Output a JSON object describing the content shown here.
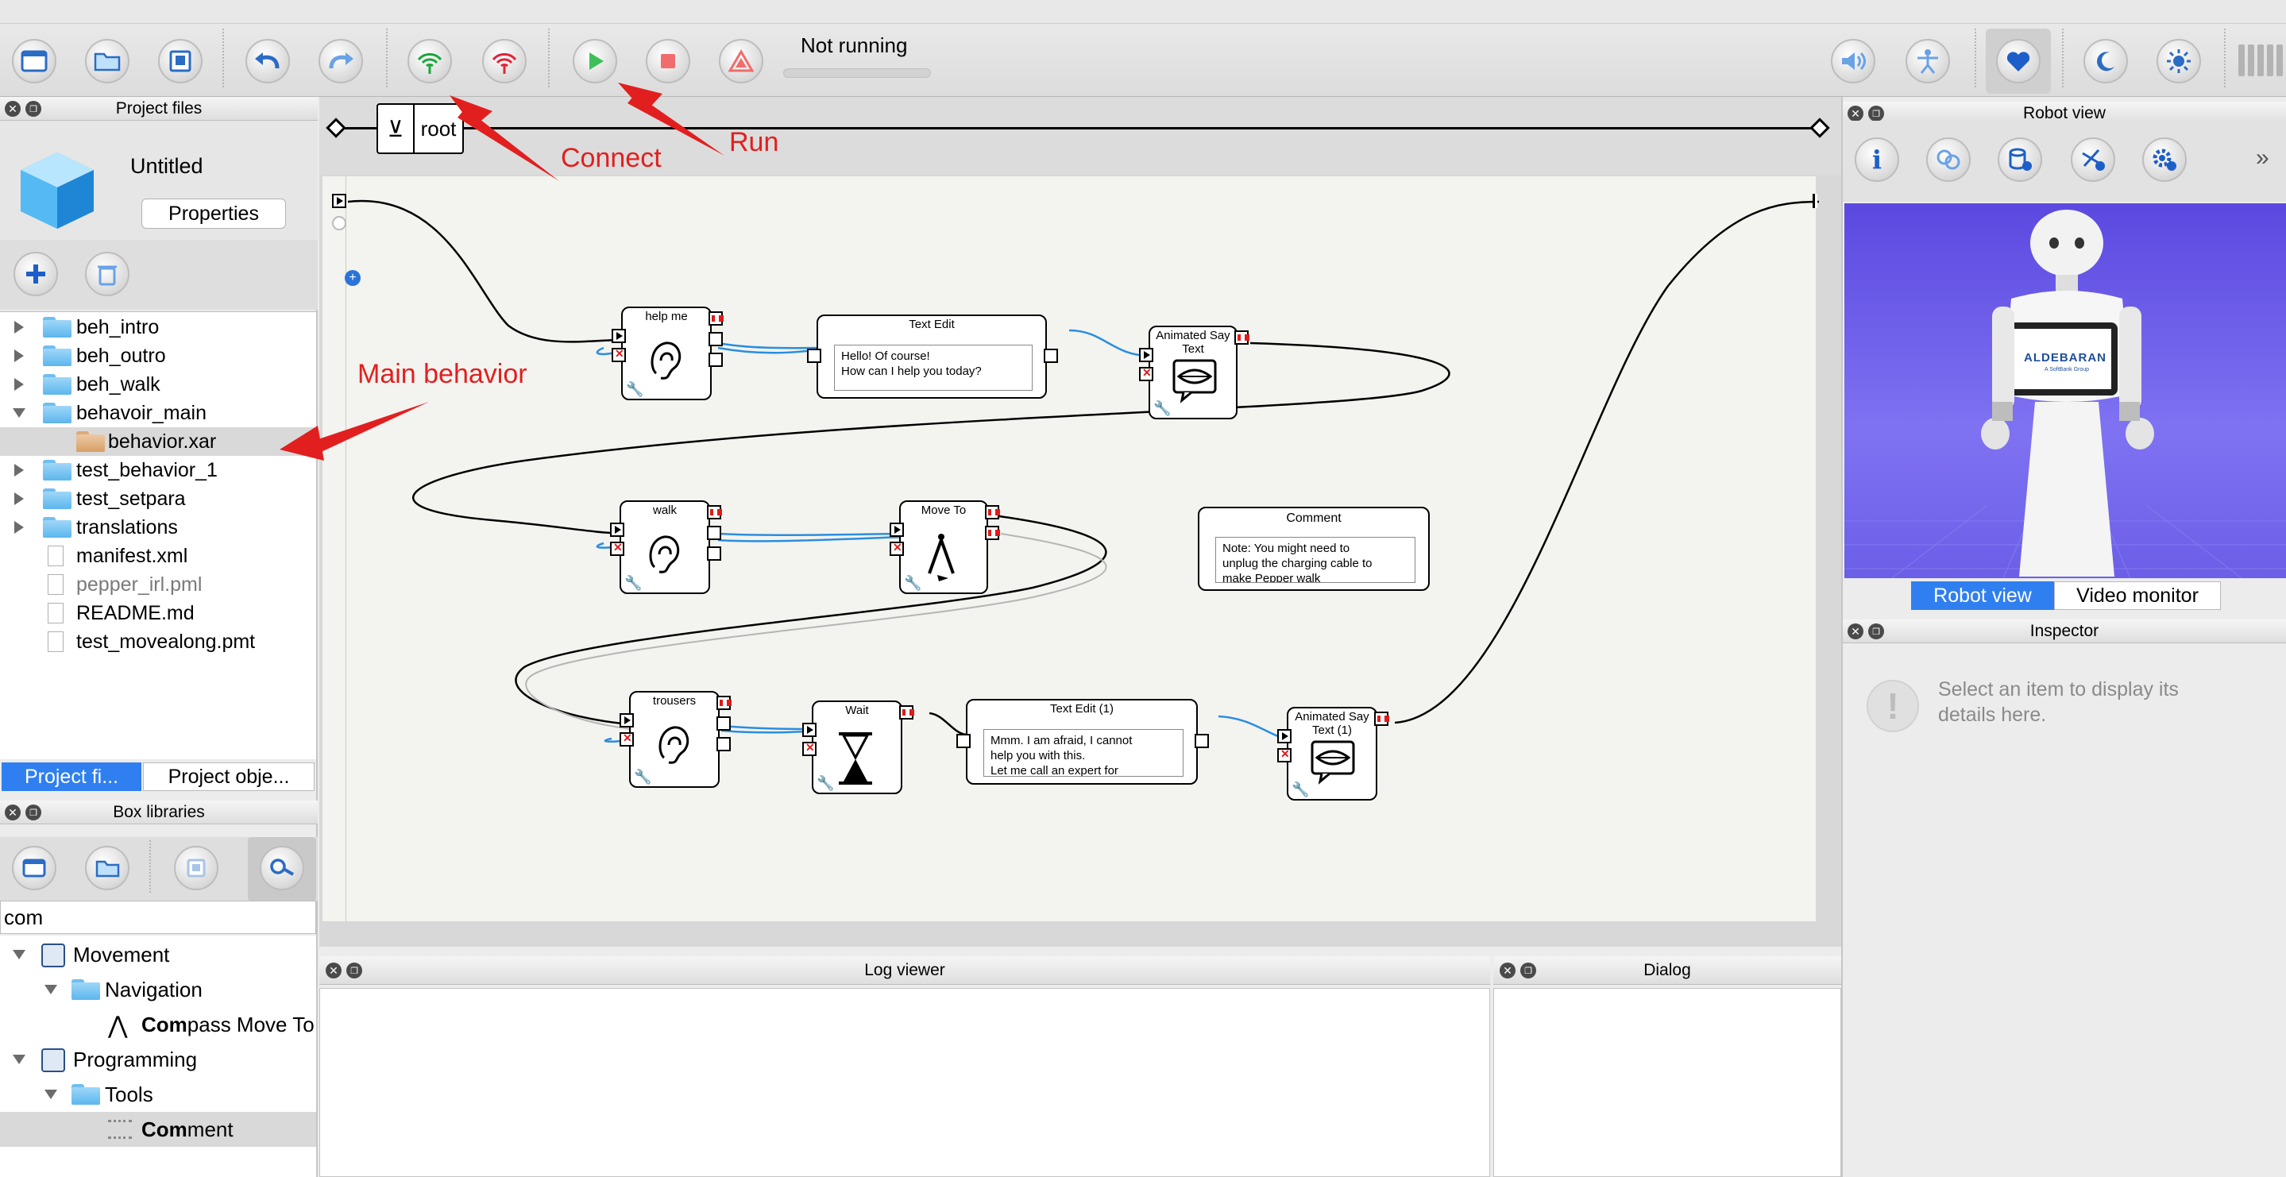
{
  "toolbar": {
    "status": "Not running",
    "buttons": [
      "new-project",
      "open-project",
      "save-project",
      "undo",
      "redo",
      "connect",
      "disconnect",
      "play",
      "stop",
      "alert"
    ],
    "right_buttons": [
      "volume",
      "animation-mode",
      "autonomous-life",
      "rest",
      "wake-up"
    ]
  },
  "project_files": {
    "header": "Project files",
    "project_name": "Untitled",
    "properties_label": "Properties",
    "tree": [
      {
        "label": "beh_intro",
        "type": "folder",
        "expand": "right"
      },
      {
        "label": "beh_outro",
        "type": "folder",
        "expand": "right"
      },
      {
        "label": "beh_walk",
        "type": "folder",
        "expand": "right"
      },
      {
        "label": "behavoir_main",
        "type": "folder",
        "expand": "down"
      },
      {
        "label": "behavior.xar",
        "type": "xar",
        "expand": "",
        "indent": true,
        "selected": true
      },
      {
        "label": "test_behavior_1",
        "type": "folder",
        "expand": "right"
      },
      {
        "label": "test_setpara",
        "type": "folder",
        "expand": "right"
      },
      {
        "label": "translations",
        "type": "folder",
        "expand": "right"
      },
      {
        "label": "manifest.xml",
        "type": "file",
        "expand": ""
      },
      {
        "label": "pepper_irl.pml",
        "type": "pml",
        "expand": "",
        "muted": true
      },
      {
        "label": "README.md",
        "type": "file",
        "expand": ""
      },
      {
        "label": "test_movealong.pmt",
        "type": "file",
        "expand": ""
      }
    ],
    "tabs": [
      "Project fi...",
      "Project obje..."
    ]
  },
  "box_libraries": {
    "header": "Box libraries",
    "search_value": "com",
    "tree": [
      {
        "label": "Movement",
        "level": 0,
        "icon": "library"
      },
      {
        "label": "Navigation",
        "level": 1,
        "icon": "folder"
      },
      {
        "match": "Com",
        "rest": "pass Move To",
        "level": 2,
        "icon": "compass-box"
      },
      {
        "label": "Programming",
        "level": 0,
        "icon": "library"
      },
      {
        "label": "Tools",
        "level": 1,
        "icon": "folder"
      },
      {
        "match": "Com",
        "rest": "ment",
        "level": 2,
        "icon": "comment-box",
        "selected": true
      }
    ]
  },
  "canvas": {
    "breadcrumb": "root",
    "boxes": {
      "help_me": {
        "title": "help me"
      },
      "text_edit": {
        "title": "Text Edit",
        "text": "Hello! Of course!\nHow can I help you today?"
      },
      "say_text": {
        "title": "Animated Say Text"
      },
      "walk": {
        "title": "walk"
      },
      "move_to": {
        "title": "Move To"
      },
      "comment": {
        "title": "Comment",
        "text": "Note: You might need to\nunplug the charging cable to\nmake Pepper walk"
      },
      "trousers": {
        "title": "trousers"
      },
      "wait": {
        "title": "Wait"
      },
      "text_edit_1": {
        "title": "Text Edit (1)",
        "text": "Mmm. I am afraid, I cannot\nhelp you with this.\nLet me call an expert for"
      },
      "say_text_1": {
        "title": "Animated Say Text (1)"
      }
    }
  },
  "annotations": {
    "connect": "Connect",
    "run": "Run",
    "main_behavior": "Main behavior",
    "color": "#e21f1f"
  },
  "robot_view": {
    "header": "Robot view",
    "tabs": [
      "Robot view",
      "Video monitor"
    ],
    "tablet_brand": "ALDEBARAN",
    "tablet_sub": "A SoftBank Group"
  },
  "inspector": {
    "header": "Inspector",
    "placeholder": "Select an item to display its details here."
  },
  "log_viewer": {
    "header": "Log viewer"
  },
  "dialog": {
    "header": "Dialog"
  },
  "colors": {
    "accent": "#2f7ff0",
    "wire_blue": "#2a8ee0",
    "arrow_red": "#e21f1f"
  }
}
